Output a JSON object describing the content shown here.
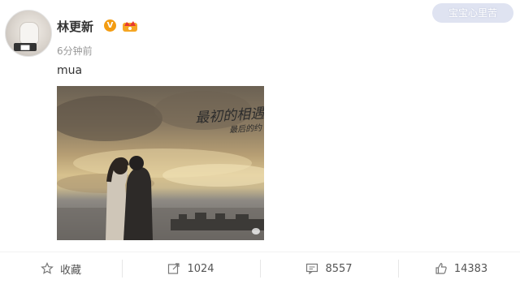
{
  "user": {
    "name": "林更新",
    "verified_badge": "V",
    "time": "6分钟前"
  },
  "watermark": "宝宝心里苦",
  "post": {
    "text": "mua",
    "photo_caption_line1": "最初的相遇",
    "photo_caption_line2": "最后的约"
  },
  "actions": [
    {
      "label": "收藏",
      "icon": "star-icon"
    },
    {
      "label": "1024",
      "icon": "share-icon"
    },
    {
      "label": "8557",
      "icon": "comment-icon"
    },
    {
      "label": "14383",
      "icon": "like-icon"
    }
  ],
  "colors": {
    "badge": "#f39c12",
    "text": "#333333",
    "muted": "#999999"
  }
}
